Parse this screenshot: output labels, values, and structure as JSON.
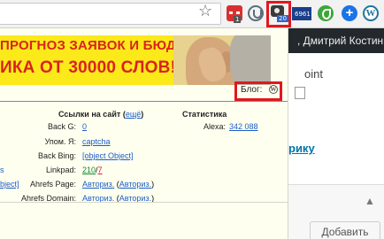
{
  "toolbar": {
    "star_icon": "star-icon",
    "extensions": [
      {
        "name": "ext-red-dots-icon",
        "badge": "1"
      },
      {
        "name": "ext-tracker-icon",
        "badge": ""
      },
      {
        "name": "ext-seo-popup-icon",
        "badge": "20"
      },
      {
        "name": "ext-counter-icon",
        "badge": "6961"
      },
      {
        "name": "ext-evernote-icon",
        "badge": ""
      },
      {
        "name": "ext-add-icon",
        "badge": "+"
      },
      {
        "name": "ext-wordpress-icon",
        "badge": "W"
      }
    ]
  },
  "background": {
    "greeting": ", Дмитрий Костин",
    "frag_point": "oint",
    "frag_riku": "рику",
    "add_button": "Добавить",
    "toggle": "▲"
  },
  "popup": {
    "banner": {
      "line1": "ПРОГНОЗ ЗАЯВОК И БЮДЖЕТА,",
      "line2": "ИКА ОТ 30000 СЛОВ!"
    },
    "blog_label": "Блог:",
    "blog_icon": "W",
    "links_section": {
      "title": "Ссылки на сайт",
      "more_link": "ещё",
      "rows": [
        {
          "label": "Back G:",
          "value": "0"
        },
        {
          "label": "Упом. Я:",
          "value": "captcha"
        },
        {
          "label": "Back Bing:",
          "value": "[object Object]"
        },
        {
          "label": "Linkpad:",
          "value_good": "210",
          "value_bad": "7"
        },
        {
          "label": "Ahrefs Page:",
          "value": "Авториз.",
          "value2": "Авториз."
        },
        {
          "label": "Ahrefs Domain:",
          "value": "Авториз.",
          "value2": "Авториз."
        }
      ]
    },
    "stats_section": {
      "title": "Статистика",
      "alexa_label": "Alexa:",
      "alexa_value": "342 088"
    },
    "left_fragments": [
      "s",
      "bject]"
    ]
  }
}
